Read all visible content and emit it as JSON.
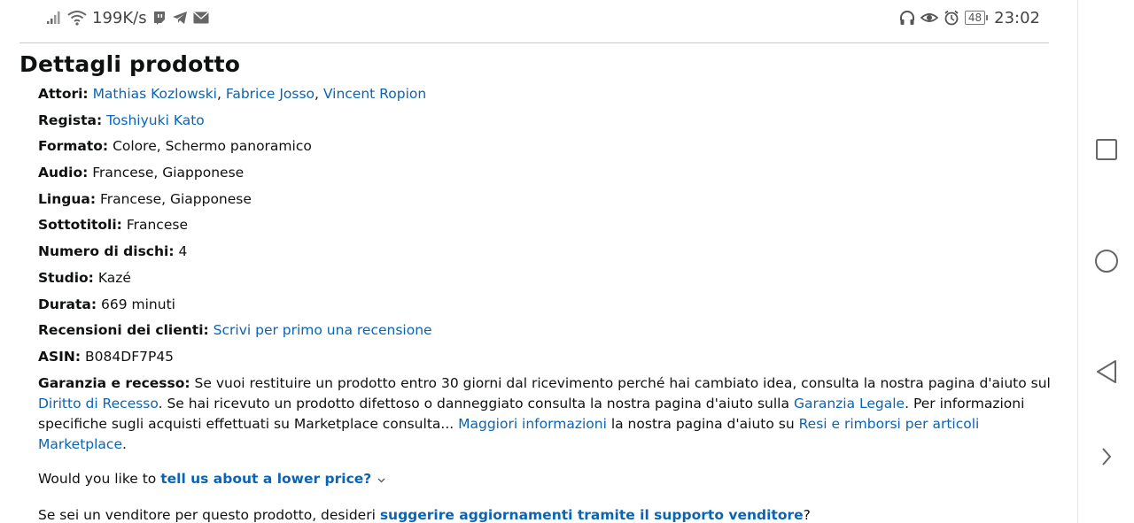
{
  "status_bar": {
    "net_speed": "199K/s",
    "battery_level": "48",
    "time": "23:02"
  },
  "page": {
    "title": "Dettagli prodotto",
    "details": [
      {
        "label": "Attori:",
        "values": [
          {
            "text": "Mathias Kozlowski",
            "link": true
          },
          {
            "text": "Fabrice Josso",
            "link": true
          },
          {
            "text": "Vincent Ropion",
            "link": true
          }
        ]
      },
      {
        "label": "Regista:",
        "values": [
          {
            "text": "Toshiyuki Kato",
            "link": true
          }
        ]
      },
      {
        "label": "Formato:",
        "values": [
          {
            "text": "Colore, Schermo panoramico",
            "link": false
          }
        ]
      },
      {
        "label": "Audio:",
        "values": [
          {
            "text": "Francese, Giapponese",
            "link": false
          }
        ]
      },
      {
        "label": "Lingua:",
        "values": [
          {
            "text": "Francese, Giapponese",
            "link": false
          }
        ]
      },
      {
        "label": "Sottotitoli:",
        "values": [
          {
            "text": "Francese",
            "link": false
          }
        ]
      },
      {
        "label": "Numero di dischi:",
        "values": [
          {
            "text": "4",
            "link": false
          }
        ]
      },
      {
        "label": "Studio:",
        "values": [
          {
            "text": "Kazé",
            "link": false
          }
        ]
      },
      {
        "label": "Durata:",
        "values": [
          {
            "text": "669 minuti",
            "link": false
          }
        ]
      },
      {
        "label": "Recensioni dei clienti:",
        "values": [
          {
            "text": "Scrivi per primo una recensione",
            "link": true
          }
        ]
      },
      {
        "label": "ASIN:",
        "values": [
          {
            "text": "B084DF7P45",
            "link": false
          }
        ]
      }
    ],
    "warranty": {
      "label": "Garanzia e recesso:",
      "text1": "Se vuoi restituire un prodotto entro 30 giorni dal ricevimento perché hai cambiato idea, consulta la nostra pagina d'aiuto sul",
      "link1": "Diritto di Recesso",
      "text2": ". Se hai ricevuto un prodotto difettoso o danneggiato consulta la nostra pagina d'aiuto sulla",
      "link2": "Garanzia Legale",
      "text3": ". Per informazioni specifiche sugli acquisti effettuati su Marketplace consulta...",
      "link3": "Maggiori informazioni",
      "text4": "la nostra pagina d'aiuto su",
      "link4": "Resi e rimborsi per articoli Marketplace",
      "text5": "."
    },
    "lower_price": {
      "prefix": "Would you like to",
      "link": "tell us about a lower price?"
    },
    "seller": {
      "prefix": "Se sei un venditore per questo prodotto, desideri",
      "link": "suggerire aggiornamenti tramite il supporto venditore",
      "suffix": "?"
    }
  },
  "nav_bar": {
    "icons": [
      "recents-square-icon",
      "home-circle-icon",
      "back-triangle-icon",
      "forward-chevron-icon"
    ]
  }
}
